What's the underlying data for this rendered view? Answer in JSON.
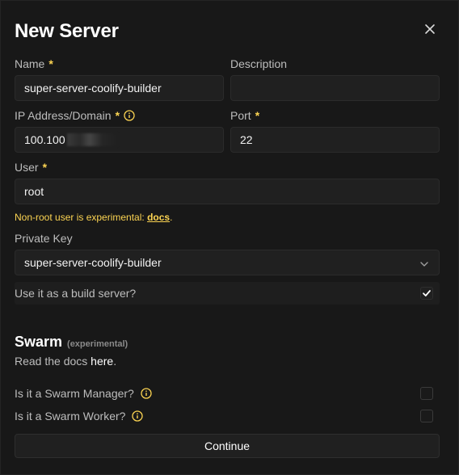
{
  "dialog": {
    "title": "New Server"
  },
  "fields": {
    "name": {
      "label": "Name",
      "required_mark": "*",
      "value": "super-server-coolify-builder"
    },
    "description": {
      "label": "Description",
      "value": ""
    },
    "ip": {
      "label": "IP Address/Domain",
      "required_mark": "*",
      "value": "100.100"
    },
    "port": {
      "label": "Port",
      "required_mark": "*",
      "value": "22"
    },
    "user": {
      "label": "User",
      "required_mark": "*",
      "value": "root"
    },
    "user_warning": {
      "text": "Non-root user is experimental: ",
      "link": "docs",
      "suffix": "."
    },
    "private_key": {
      "label": "Private Key",
      "selected": "super-server-coolify-builder"
    },
    "build_server": {
      "label": "Use it as a build server?",
      "checked": true
    }
  },
  "swarm": {
    "title": "Swarm",
    "subtitle": "(experimental)",
    "docs_prefix": "Read the docs ",
    "docs_link": "here",
    "docs_suffix": ".",
    "manager": {
      "label": "Is it a Swarm Manager?",
      "checked": false
    },
    "worker": {
      "label": "Is it a Swarm Worker?",
      "checked": false
    }
  },
  "actions": {
    "continue_label": "Continue"
  },
  "icons": {
    "close": "close-icon",
    "info": "info-icon",
    "chevron": "chevron-down-icon",
    "check": "check-icon"
  },
  "colors": {
    "background": "#181818",
    "input_bg": "#202020",
    "accent_yellow": "#fcd452",
    "text": "#e5e5e5",
    "muted": "#bdbdbd"
  }
}
